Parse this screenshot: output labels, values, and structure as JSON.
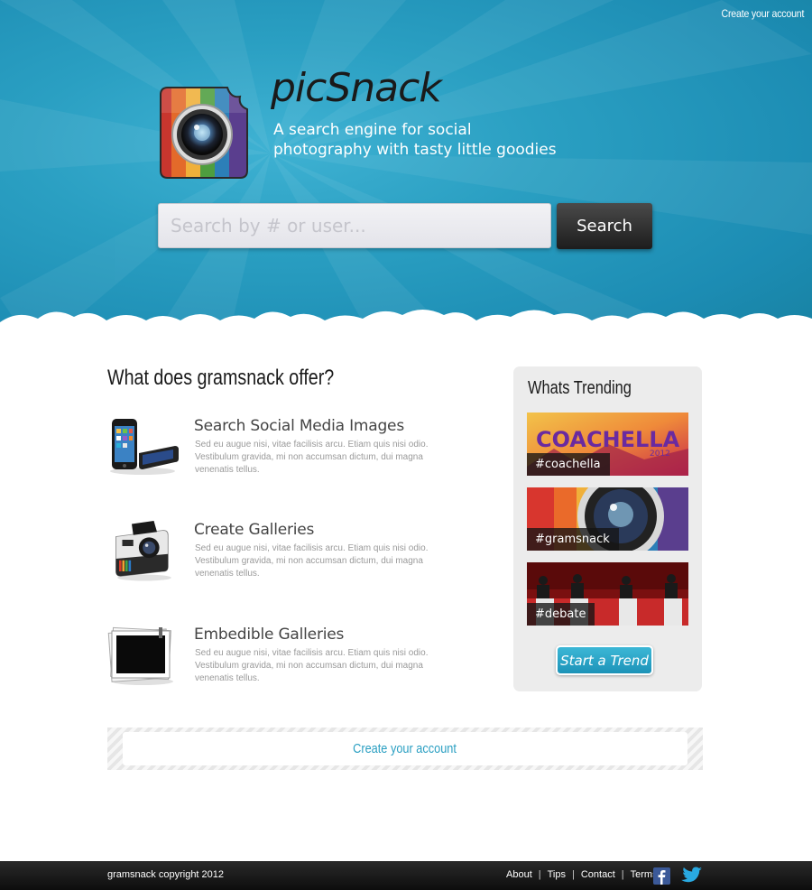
{
  "header": {
    "top_link": "Create your account",
    "app_name": "picSnack",
    "tagline": "A search engine for social photography with tasty little goodies"
  },
  "search": {
    "placeholder": "Search by # or user...",
    "button_label": "Search"
  },
  "offer": {
    "title": "What does gramsnack offer?",
    "features": [
      {
        "heading": "Search Social Media Images",
        "body": "Sed eu augue nisi, vitae facilisis arcu. Etiam quis nisi odio. Vestibulum gravida, mi non accumsan dictum, dui magna venenatis tellus.",
        "icon": "smartphones-icon"
      },
      {
        "heading": "Create Galleries",
        "body": "Sed eu augue nisi, vitae facilisis arcu. Etiam quis nisi odio. Vestibulum gravida, mi non accumsan dictum, dui magna venenatis tellus.",
        "icon": "polaroid-camera-icon"
      },
      {
        "heading": "Embedible Galleries",
        "body": "Sed eu augue nisi, vitae facilisis arcu. Etiam quis nisi odio. Vestibulum gravida, mi non accumsan dictum, dui magna venenatis tellus.",
        "icon": "photo-stack-icon"
      }
    ]
  },
  "trending": {
    "title": "Whats Trending",
    "items": [
      {
        "tag": "#coachella",
        "image_text": "COACHELLA",
        "image_subtext": "2012"
      },
      {
        "tag": "#gramsnack"
      },
      {
        "tag": "#debate"
      }
    ],
    "start_label": "Start a Trend"
  },
  "cta": {
    "label": "Create your account"
  },
  "footer": {
    "copyright": "gramsnack copyright 2012",
    "links": [
      "About",
      "Tips",
      "Contact",
      "Terms"
    ],
    "social": [
      "facebook-icon",
      "twitter-icon"
    ]
  },
  "colors": {
    "hero_blue": "#2a9fc2",
    "accent_blue": "#3cb7d6",
    "footer_dark": "#1a1a1a"
  }
}
